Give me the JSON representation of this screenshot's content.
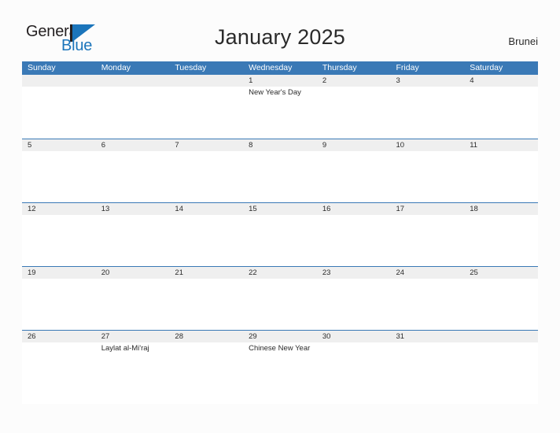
{
  "brand": {
    "name_part1": "General",
    "name_part2": "Blue",
    "logo_icon": "blue-triangle-mark"
  },
  "header": {
    "title": "January 2025",
    "locale": "Brunei"
  },
  "calendar": {
    "weekday_headers": [
      "Sunday",
      "Monday",
      "Tuesday",
      "Wednesday",
      "Thursday",
      "Friday",
      "Saturday"
    ],
    "weeks": [
      {
        "days": [
          {
            "date": "",
            "events": []
          },
          {
            "date": "",
            "events": []
          },
          {
            "date": "",
            "events": []
          },
          {
            "date": "1",
            "events": [
              "New Year's Day"
            ]
          },
          {
            "date": "2",
            "events": []
          },
          {
            "date": "3",
            "events": []
          },
          {
            "date": "4",
            "events": []
          }
        ]
      },
      {
        "days": [
          {
            "date": "5",
            "events": []
          },
          {
            "date": "6",
            "events": []
          },
          {
            "date": "7",
            "events": []
          },
          {
            "date": "8",
            "events": []
          },
          {
            "date": "9",
            "events": []
          },
          {
            "date": "10",
            "events": []
          },
          {
            "date": "11",
            "events": []
          }
        ]
      },
      {
        "days": [
          {
            "date": "12",
            "events": []
          },
          {
            "date": "13",
            "events": []
          },
          {
            "date": "14",
            "events": []
          },
          {
            "date": "15",
            "events": []
          },
          {
            "date": "16",
            "events": []
          },
          {
            "date": "17",
            "events": []
          },
          {
            "date": "18",
            "events": []
          }
        ]
      },
      {
        "days": [
          {
            "date": "19",
            "events": []
          },
          {
            "date": "20",
            "events": []
          },
          {
            "date": "21",
            "events": []
          },
          {
            "date": "22",
            "events": []
          },
          {
            "date": "23",
            "events": []
          },
          {
            "date": "24",
            "events": []
          },
          {
            "date": "25",
            "events": []
          }
        ]
      },
      {
        "days": [
          {
            "date": "26",
            "events": []
          },
          {
            "date": "27",
            "events": [
              "Laylat al-Mi'raj"
            ]
          },
          {
            "date": "28",
            "events": []
          },
          {
            "date": "29",
            "events": [
              "Chinese New Year"
            ]
          },
          {
            "date": "30",
            "events": []
          },
          {
            "date": "31",
            "events": []
          },
          {
            "date": "",
            "events": []
          }
        ]
      }
    ]
  },
  "colors": {
    "header_blue": "#3a79b6",
    "brand_blue": "#1b75bb",
    "date_band": "#efefef",
    "page_background": "#fcfcfc",
    "text": "#2b2b2b"
  }
}
